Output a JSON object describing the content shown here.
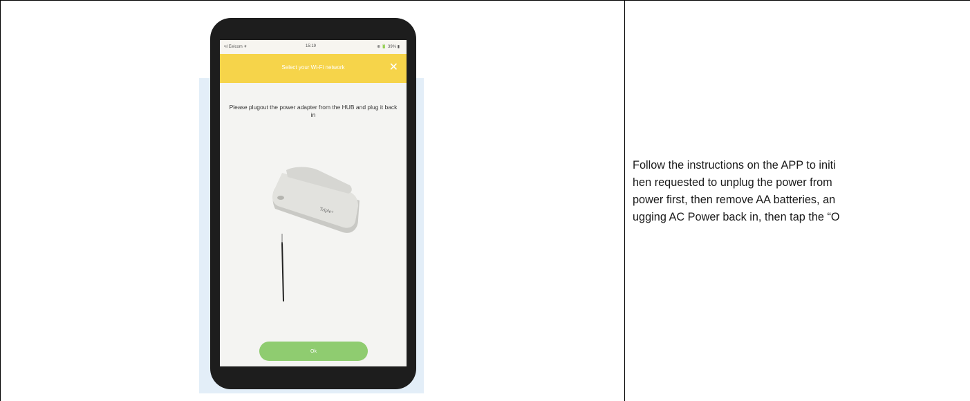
{
  "phone": {
    "status": {
      "carrier": "•ıl Eelcom ✈",
      "time": "15:19",
      "battery": "⊕ 🔋 39% ▮"
    },
    "header": {
      "title": "Select your Wi-Fi network",
      "close_glyph": "✕"
    },
    "instruction": "Please plugout the power adapter from the HUB and plug it back in",
    "hub_brand": "Triple+",
    "ok_label": "Ok"
  },
  "instructions_text": {
    "line1": "Follow the instructions on the APP to initi",
    "line2": "hen requested to unplug the power from",
    "line3": "power first, then remove AA batteries, an",
    "line4": "ugging AC Power back in, then tap the “O"
  },
  "colors": {
    "header_yellow": "#f6d44a",
    "ok_green": "#8fcc70",
    "backdrop_blue": "#e3eef8",
    "phone_body": "#1d1d1d"
  }
}
